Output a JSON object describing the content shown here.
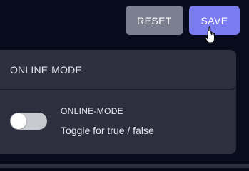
{
  "toolbar": {
    "reset_label": "RESET",
    "save_label": "SAVE"
  },
  "panel": {
    "title": "ONLINE-MODE",
    "setting": {
      "name": "ONLINE-MODE",
      "description": "Toggle for true / false",
      "value": false
    }
  },
  "colors": {
    "background": "#070b1c",
    "panel": "#2d2f3e",
    "reset_button": "#7b7f8f",
    "save_button": "#7b7cf0",
    "toggle_off": "#c9cad0"
  },
  "cursor": {
    "icon": "hand-pointer-icon"
  }
}
